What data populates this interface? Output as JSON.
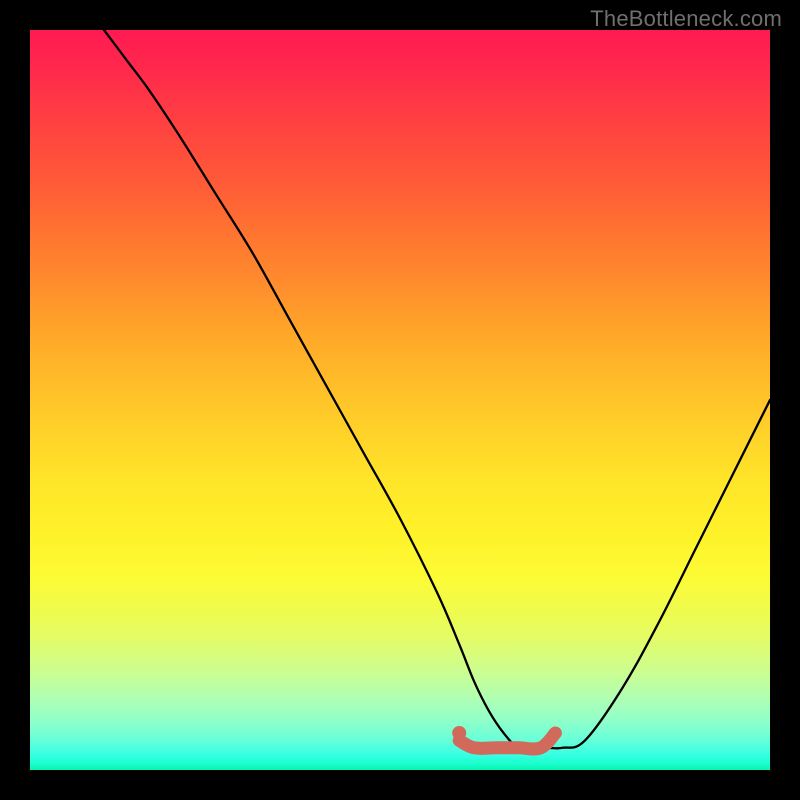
{
  "watermark": "TheBottleneck.com",
  "chart_data": {
    "type": "line",
    "title": "",
    "xlabel": "",
    "ylabel": "",
    "xlim": [
      0,
      100
    ],
    "ylim": [
      0,
      100
    ],
    "grid": false,
    "series": [
      {
        "name": "bottleneck-curve",
        "color": "#000000",
        "x": [
          10,
          13,
          16,
          20,
          25,
          30,
          35,
          40,
          45,
          50,
          55,
          58,
          60,
          62,
          64,
          66,
          68,
          70,
          72,
          75,
          80,
          85,
          90,
          95,
          100
        ],
        "y": [
          100,
          96,
          92,
          86,
          78,
          70,
          61,
          52,
          43,
          34,
          24,
          17,
          12,
          8,
          5,
          3,
          3,
          3,
          3,
          4,
          11,
          20,
          30,
          40,
          50
        ]
      },
      {
        "name": "highlight-segment",
        "color": "#d26a5c",
        "x": [
          58,
          60,
          63,
          66,
          69,
          71
        ],
        "y": [
          4,
          3,
          3,
          3,
          3,
          5
        ]
      }
    ],
    "markers": [
      {
        "name": "highlight-start-dot",
        "x": 58,
        "y": 5,
        "color": "#d26a5c"
      }
    ]
  }
}
